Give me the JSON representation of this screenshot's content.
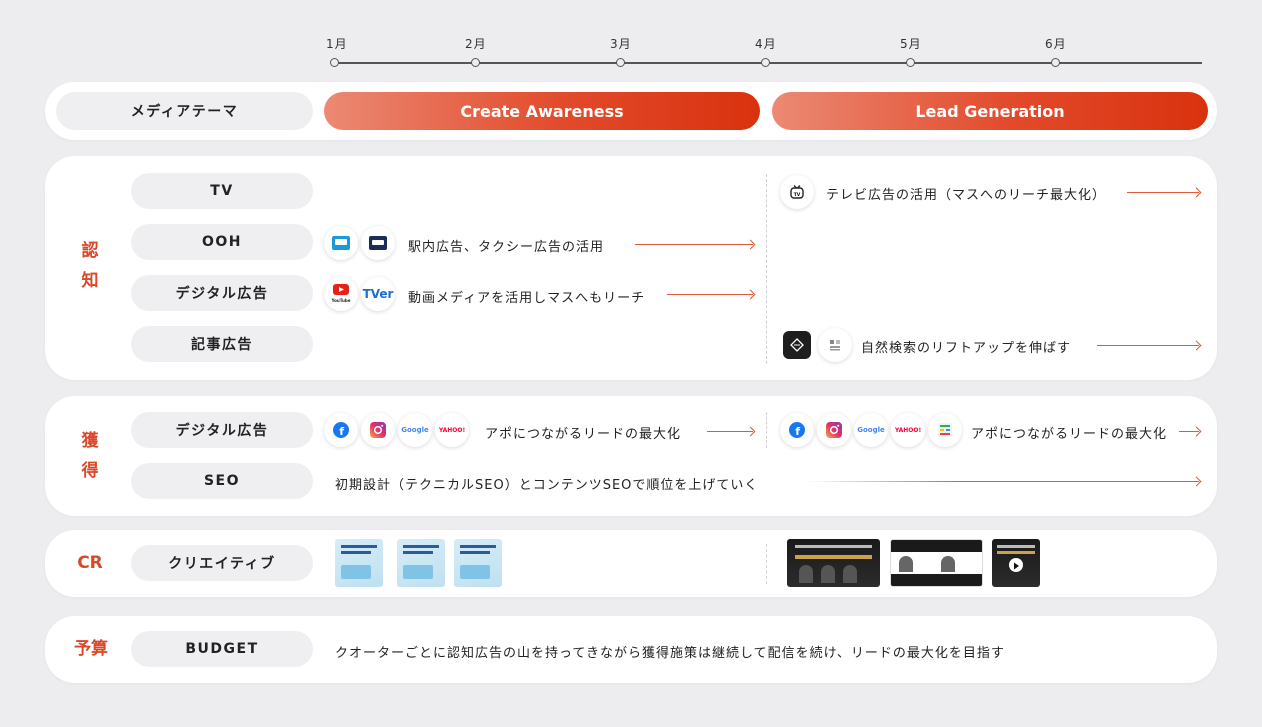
{
  "timeline": {
    "months": [
      "1月",
      "2月",
      "3月",
      "4月",
      "5月",
      "6月"
    ]
  },
  "theme_row": {
    "label": "メディアテーマ",
    "phases": [
      "Create Awareness",
      "Lead Generation"
    ]
  },
  "categories": {
    "awareness": "認\n知",
    "acquisition": "獲\n得",
    "creative": "CR",
    "budget": "予算"
  },
  "rows": {
    "tv": "TV",
    "ooh": "OOH",
    "digital_aw": "デジタル広告",
    "article": "記事広告",
    "digital_acq": "デジタル広告",
    "seo": "SEO",
    "creative": "クリエイティブ",
    "budget": "BUDGET"
  },
  "texts": {
    "tv": "テレビ広告の活用（マスへのリーチ最大化）",
    "ooh": "駅内広告、タクシー広告の活用",
    "digital_aw": "動画メディアを活用しマスへもリーチ",
    "article": "自然検索のリフトアップを伸ばす",
    "acq_left": "アポにつながるリードの最大化",
    "acq_right": "アポにつながるリードの最大化",
    "seo": "初期設計（テクニカルSEO）とコンテンツSEOで順位を上げていく",
    "budget": "クオーターごとに認知広告の山を持ってきながら獲得施策は継続して配信を続け、リードの最大化を目指す"
  },
  "icons": {
    "google": "Google",
    "yahoo": "YAHOO!",
    "tver": "TVer",
    "youtube": "YouTube"
  },
  "colors": {
    "accent": "#d9482a",
    "bar_start": "#eb8a74",
    "bar_end": "#d9320e"
  }
}
